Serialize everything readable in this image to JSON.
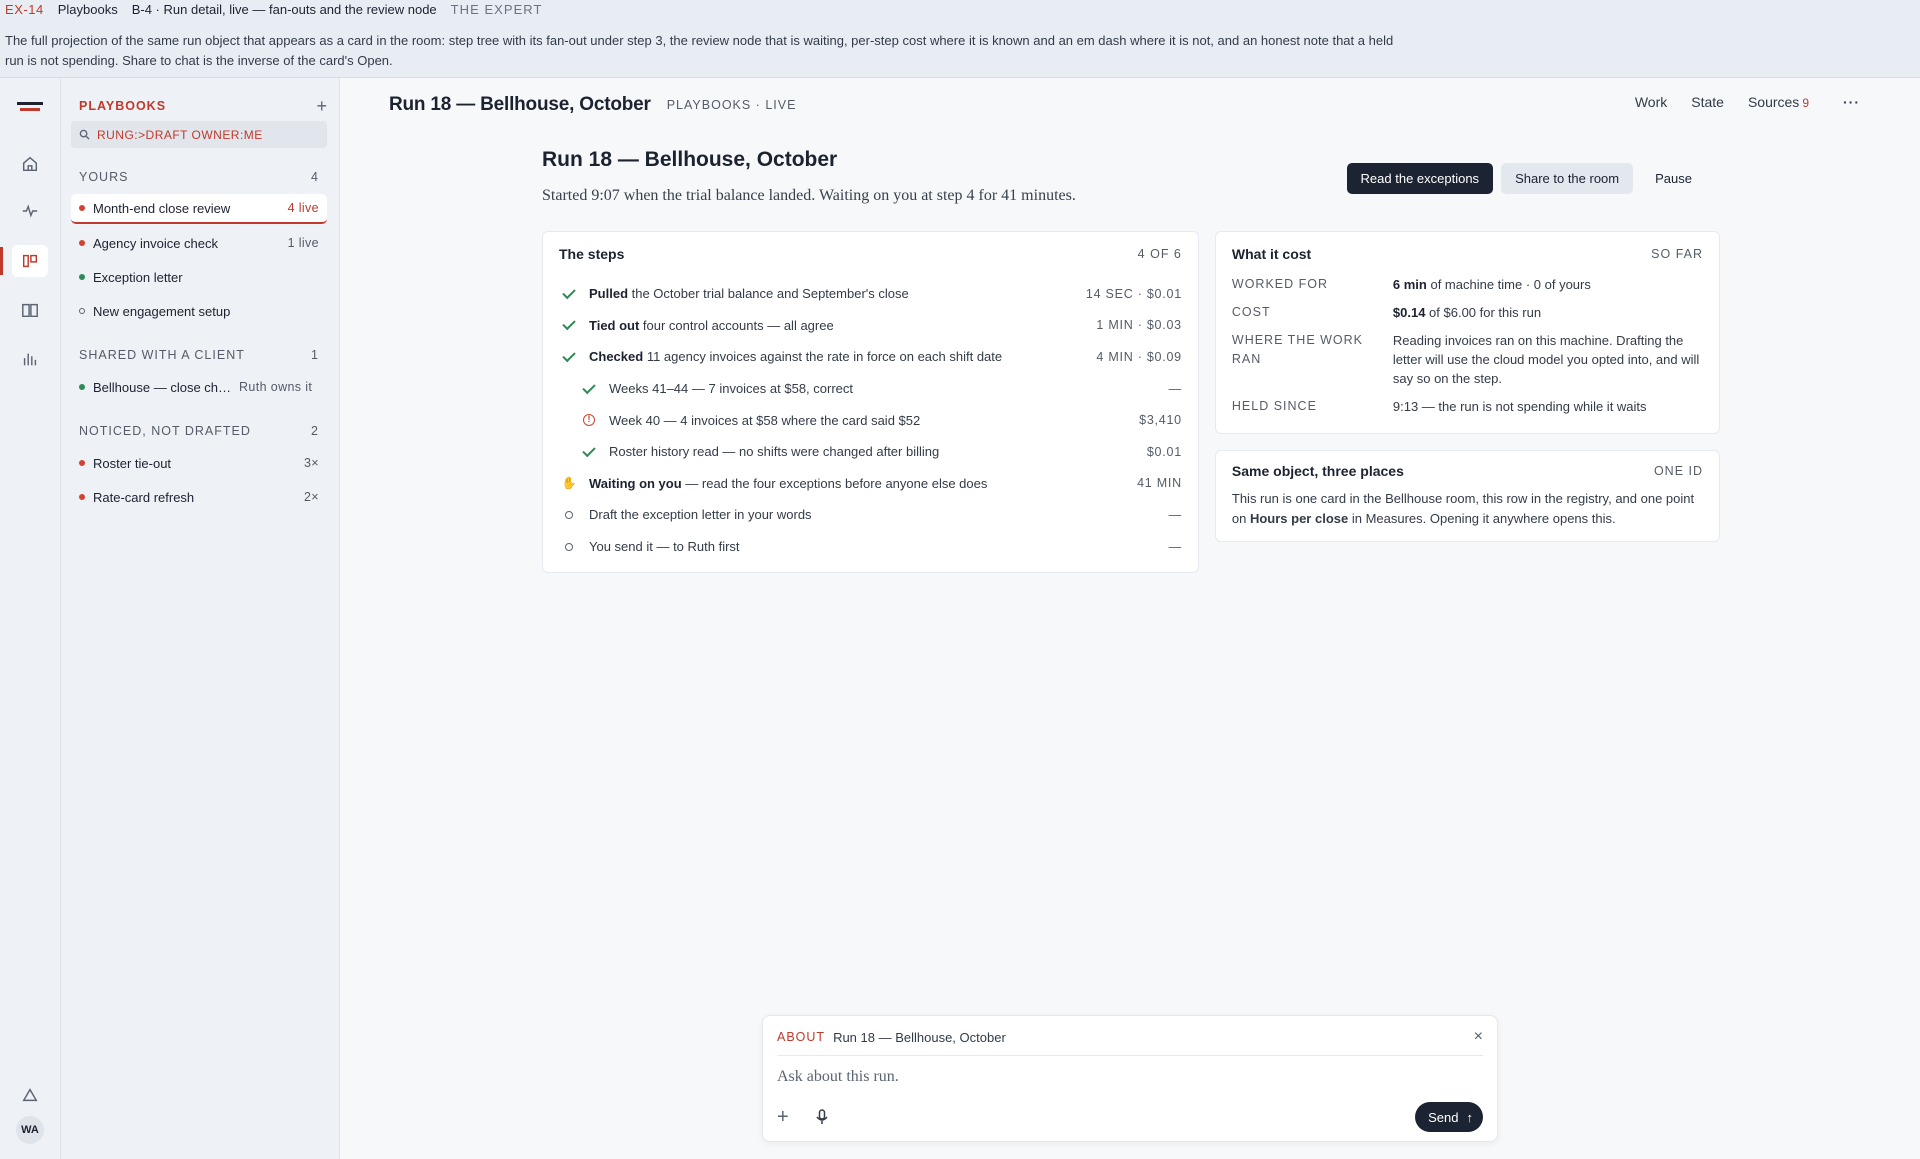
{
  "banner": {
    "code": "EX-14",
    "section": "Playbooks",
    "crumb": "B-4 · Run detail, live — fan-outs and the review node",
    "audience": "THE EXPERT",
    "description": "The full projection of the same run object that appears as a card in the room: step tree with its fan-out under step 3, the review node that is waiting, per-step cost where it is known and an em dash where it is not, and an honest note that a held run is not spending. Share to chat is the inverse of the card's Open."
  },
  "rail": {
    "icons": [
      "logo-icon",
      "home-icon",
      "pulse-icon",
      "playbooks-icon",
      "book-icon",
      "chart-icon",
      "alert-icon"
    ],
    "avatar": "WA"
  },
  "sidebar": {
    "title": "PLAYBOOKS",
    "add": "+",
    "search": "RUNG:>DRAFT OWNER:ME",
    "sections": [
      {
        "label": "YOURS",
        "count": "4",
        "items": [
          {
            "label": "Month-end close review",
            "meta": "4 live",
            "status": "red",
            "selected": true
          },
          {
            "label": "Agency invoice check",
            "meta": "1 live",
            "status": "red"
          },
          {
            "label": "Exception letter",
            "meta": "",
            "status": "green"
          },
          {
            "label": "New engagement setup",
            "meta": "",
            "status": "ring"
          }
        ]
      },
      {
        "label": "SHARED WITH A CLIENT",
        "count": "1",
        "items": [
          {
            "label": "Bellhouse — close che...",
            "meta": "Ruth owns it",
            "status": "green"
          }
        ]
      },
      {
        "label": "NOTICED, NOT DRAFTED",
        "count": "2",
        "items": [
          {
            "label": "Roster tie-out",
            "meta": "3×",
            "status": "red"
          },
          {
            "label": "Rate-card refresh",
            "meta": "2×",
            "status": "red"
          }
        ]
      }
    ]
  },
  "topbar": {
    "title": "Run 18 — Bellhouse, October",
    "crumb": "PLAYBOOKS · LIVE",
    "nav": {
      "work": "Work",
      "state": "State",
      "sources": "Sources",
      "sources_count": "9",
      "more": "···"
    }
  },
  "run": {
    "title": "Run 18 — Bellhouse, October",
    "subtitle": "Started 9:07 when the trial balance landed. Waiting on you at step 4 for 41 minutes.",
    "actions": {
      "primary": "Read the exceptions",
      "share": "Share to the room",
      "pause": "Pause"
    }
  },
  "steps": {
    "title": "The steps",
    "count": "4 OF 6",
    "rows": [
      {
        "icon": "check",
        "bold": "Pulled",
        "text": " the October trial balance and September's close",
        "value": "14 SEC · $0.01",
        "sub": false
      },
      {
        "icon": "check",
        "bold": "Tied out",
        "text": " four control accounts — all agree",
        "value": "1 MIN · $0.03",
        "sub": false
      },
      {
        "icon": "check",
        "bold": "Checked",
        "text": " 11 agency invoices against the rate in force on each shift date",
        "value": "4 MIN · $0.09",
        "sub": false
      },
      {
        "icon": "check",
        "bold": "",
        "text": "Weeks 41–44 — 7 invoices at $58, correct",
        "value": "—",
        "sub": true
      },
      {
        "icon": "warn",
        "bold": "",
        "text": "Week 40 — 4 invoices at $58 where the card said $52",
        "value": "$3,410",
        "sub": true
      },
      {
        "icon": "check",
        "bold": "",
        "text": "Roster history read — no shifts were changed after billing",
        "value": "$0.01",
        "sub": true
      },
      {
        "icon": "hand",
        "bold": "Waiting on you",
        "text": " — read the four exceptions before anyone else does",
        "value": "41 MIN",
        "sub": false
      },
      {
        "icon": "ring",
        "bold": "",
        "text": "Draft the exception letter in your words",
        "value": "—",
        "sub": false
      },
      {
        "icon": "ring",
        "bold": "",
        "text": "You send it — to Ruth first",
        "value": "—",
        "sub": false
      }
    ]
  },
  "cost": {
    "title": "What it cost",
    "tag": "SO FAR",
    "rows": [
      {
        "key": "WORKED FOR",
        "bold": "6 min",
        "text": " of machine time · 0 of yours"
      },
      {
        "key": "COST",
        "bold": "$0.14",
        "text": " of $6.00 for this run"
      },
      {
        "key": "WHERE THE WORK RAN",
        "bold": "",
        "text": "Reading invoices ran on this machine. Drafting the letter will use the cloud model you opted into, and will say so on the step."
      },
      {
        "key": "HELD SINCE",
        "bold": "",
        "text": "9:13 — the run is not spending while it waits"
      }
    ]
  },
  "same": {
    "title": "Same object, three places",
    "tag": "ONE ID",
    "text_a": "This run is one card in the Bellhouse room, this row in the registry, and one point on ",
    "text_bold": "Hours per close",
    "text_b": " in Measures. Opening it anywhere opens this."
  },
  "composer": {
    "about": "ABOUT",
    "run": "Run 18 — Bellhouse, October",
    "close": "×",
    "placeholder": "Ask about this run.",
    "plus": "+",
    "send": "Send"
  },
  "colors": {
    "accent": "#c0392b",
    "dark": "#1c2433",
    "ok": "#2f8a57",
    "hold": "#d08a1f"
  }
}
